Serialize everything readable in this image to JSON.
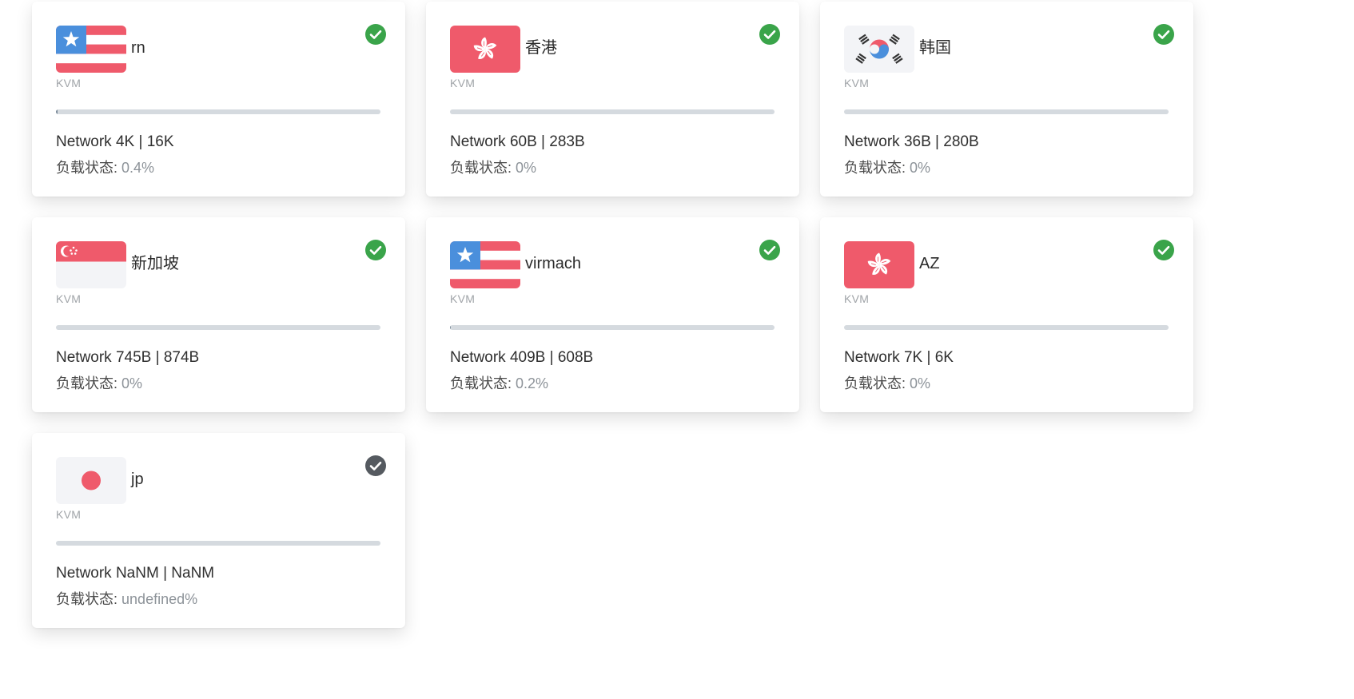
{
  "colors": {
    "online_check": "#3aa44a",
    "offline_check": "#555a60",
    "flag_red": "#ef5a6b",
    "flag_blue": "#4a8fdc",
    "flag_light": "#f3f4f7"
  },
  "cards": [
    {
      "flag": "us",
      "name": "rn",
      "type": "KVM",
      "online": true,
      "load_fraction": 0.004,
      "network": "Network 4K | 16K",
      "load_label": "负载状态:",
      "load_value": "0.4%"
    },
    {
      "flag": "hk",
      "name": "香港",
      "type": "KVM",
      "online": true,
      "load_fraction": 0,
      "network": "Network 60B | 283B",
      "load_label": "负载状态:",
      "load_value": "0%"
    },
    {
      "flag": "kr",
      "name": "韩国",
      "type": "KVM",
      "online": true,
      "load_fraction": 0,
      "network": "Network 36B | 280B",
      "load_label": "负载状态:",
      "load_value": "0%"
    },
    {
      "flag": "sg",
      "name": "新加坡",
      "type": "KVM",
      "online": true,
      "load_fraction": 0,
      "network": "Network 745B | 874B",
      "load_label": "负载状态:",
      "load_value": "0%"
    },
    {
      "flag": "us",
      "name": "virmach",
      "type": "KVM",
      "online": true,
      "load_fraction": 0.002,
      "network": "Network 409B | 608B",
      "load_label": "负载状态:",
      "load_value": "0.2%"
    },
    {
      "flag": "hk",
      "name": "AZ",
      "type": "KVM",
      "online": true,
      "load_fraction": 0,
      "network": "Network 7K | 6K",
      "load_label": "负载状态:",
      "load_value": "0%"
    },
    {
      "flag": "jp",
      "name": "jp",
      "type": "KVM",
      "online": false,
      "load_fraction": 0,
      "network": "Network NaNM | NaNM",
      "load_label": "负载状态:",
      "load_value": "undefined%"
    }
  ]
}
